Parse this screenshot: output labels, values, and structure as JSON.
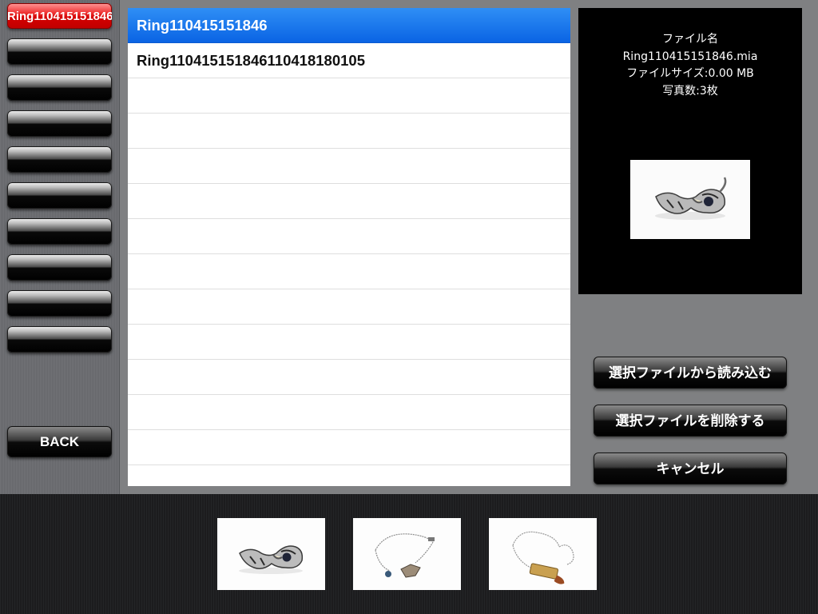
{
  "sidebar": {
    "slots": [
      {
        "label": "Ring110415151846",
        "active": true
      },
      {
        "label": ""
      },
      {
        "label": ""
      },
      {
        "label": ""
      },
      {
        "label": ""
      },
      {
        "label": ""
      },
      {
        "label": ""
      },
      {
        "label": ""
      },
      {
        "label": ""
      },
      {
        "label": ""
      }
    ],
    "back_label": "BACK"
  },
  "file_list": {
    "rows": [
      {
        "name": "Ring110415151846",
        "selected": true
      },
      {
        "name": "Ring110415151846110418180105",
        "selected": false
      },
      {
        "name": ""
      },
      {
        "name": ""
      },
      {
        "name": ""
      },
      {
        "name": ""
      },
      {
        "name": ""
      },
      {
        "name": ""
      },
      {
        "name": ""
      },
      {
        "name": ""
      },
      {
        "name": ""
      },
      {
        "name": ""
      },
      {
        "name": ""
      },
      {
        "name": ""
      }
    ]
  },
  "info": {
    "label_filename": "ファイル名",
    "filename": "Ring110415151846.mia",
    "filesize": "ファイルサイズ:0.00 MB",
    "photo_count": "写真数:3枚",
    "preview_icon": "ring-photo"
  },
  "actions": {
    "load_label": "選択ファイルから読み込む",
    "delete_label": "選択ファイルを削除する",
    "cancel_label": "キャンセル"
  },
  "thumbnails": [
    {
      "icon": "ring-photo"
    },
    {
      "icon": "necklace-photo"
    },
    {
      "icon": "bullet-pendant-photo"
    }
  ],
  "colors": {
    "selection_blue": "#0a64e4",
    "active_slot_red": "#d40000"
  }
}
